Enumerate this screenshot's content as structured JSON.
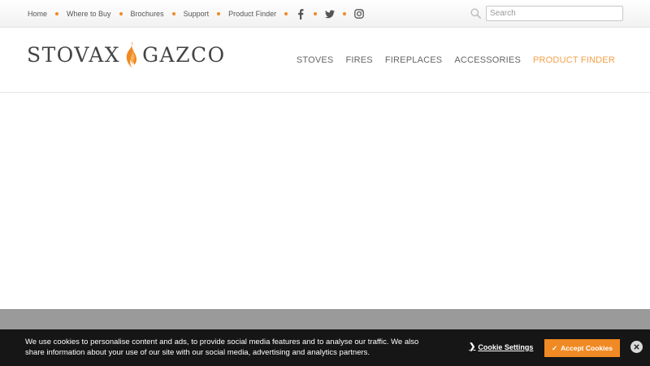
{
  "topbar": {
    "links": [
      "Home",
      "Where to Buy",
      "Brochures",
      "Support",
      "Product Finder"
    ],
    "social_icons": [
      "facebook-icon",
      "twitter-icon",
      "instagram-icon"
    ],
    "search": {
      "placeholder": "Search",
      "value": ""
    }
  },
  "header": {
    "logo": {
      "left": "STOVAX",
      "right": "GAZCO",
      "flame_colors": [
        "#f08a24",
        "#f5b35a"
      ]
    },
    "nav": [
      {
        "label": "STOVES",
        "active": false
      },
      {
        "label": "FIRES",
        "active": false
      },
      {
        "label": "FIREPLACES",
        "active": false
      },
      {
        "label": "ACCESSORIES",
        "active": false
      },
      {
        "label": "PRODUCT FINDER",
        "active": true
      }
    ]
  },
  "cookie_banner": {
    "text": "We use cookies to personalise content and ads, to provide social media features and to analyse our traffic. We also share information about your use of our site with our social media, advertising and analytics partners.",
    "settings_label": "Cookie Settings",
    "accept_label": "Accept Cookies",
    "accept_check": "✓",
    "settings_chevron": "❯",
    "close_icon": "close-icon"
  },
  "colors": {
    "accent": "#f08a24",
    "nav_active": "#f5a04a",
    "banner_bg": "#161616",
    "grey_band": "#9a9a9a"
  }
}
